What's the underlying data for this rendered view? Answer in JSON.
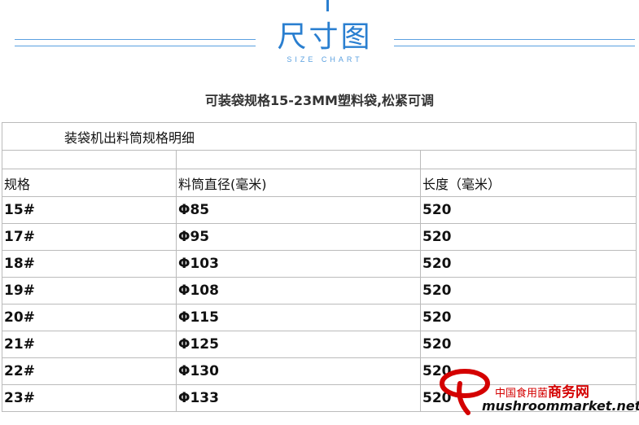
{
  "header": {
    "title": "尺寸图",
    "subtitle": "SIZE CHART",
    "accent_color": "#2a7fd0"
  },
  "caption": "可装袋规格15-23MM塑料袋,松紧可调",
  "table": {
    "section_title": "装袋机出料筒规格明细",
    "columns": [
      "规格",
      "料筒直径(毫米)",
      "长度（毫米）"
    ],
    "rows": [
      [
        "15#",
        "Φ85",
        "520"
      ],
      [
        "17#",
        "Φ95",
        "520"
      ],
      [
        "18#",
        "Φ103",
        "520"
      ],
      [
        "19#",
        "Φ108",
        "520"
      ],
      [
        "20#",
        "Φ115",
        "520"
      ],
      [
        "21#",
        "Φ125",
        "520"
      ],
      [
        "22#",
        "Φ130",
        "520"
      ],
      [
        "23#",
        "Φ133",
        "520"
      ]
    ]
  },
  "watermark": {
    "site_name_cn": "中国食用菌",
    "site_name_bold": "商务网",
    "url": "mushroommarket.net",
    "color": "#d40000"
  }
}
